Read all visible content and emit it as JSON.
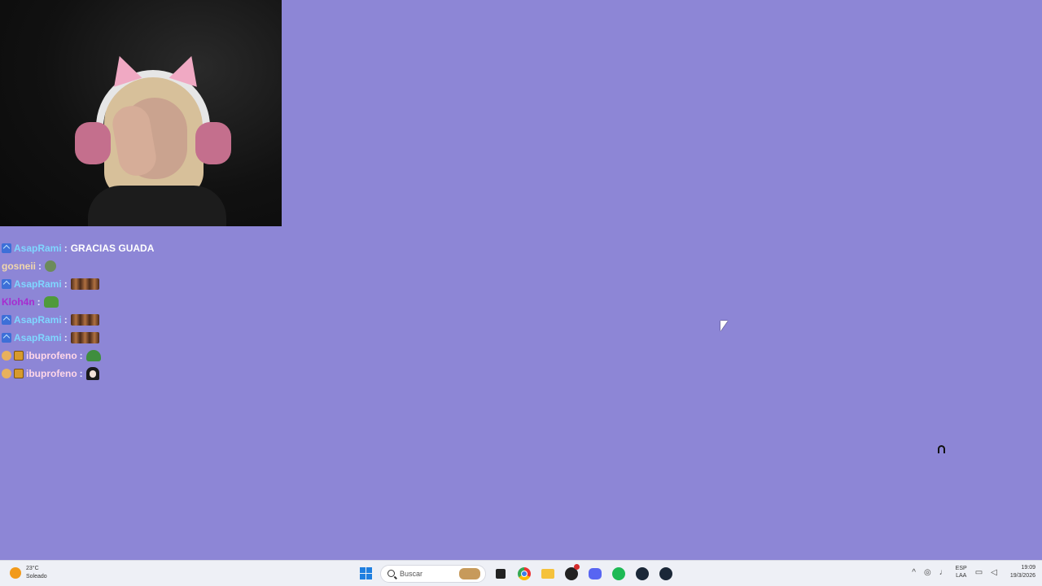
{
  "chat": {
    "messages": [
      {
        "badges": [
          "prime"
        ],
        "user": "AsapRami",
        "color": "#7fd6ff",
        "text": "GRACIAS GUADA",
        "emote": ""
      },
      {
        "badges": [],
        "user": "gosneii",
        "color": "#f1d7ab",
        "text": "",
        "emote": "frog"
      },
      {
        "badges": [
          "prime"
        ],
        "user": "AsapRami",
        "color": "#7fd6ff",
        "text": "",
        "emote": "trio"
      },
      {
        "badges": [],
        "user": "Kloh4n",
        "color": "#a72bd0",
        "text": "",
        "emote": "pepe"
      },
      {
        "badges": [
          "prime"
        ],
        "user": "AsapRami",
        "color": "#7fd6ff",
        "text": "",
        "emote": "trio"
      },
      {
        "badges": [
          "prime"
        ],
        "user": "AsapRami",
        "color": "#7fd6ff",
        "text": "",
        "emote": "trio"
      },
      {
        "badges": [
          "circle",
          "crate"
        ],
        "user": "ibuprofeno",
        "color": "#ffd7e8",
        "text": "",
        "emote": "bowl"
      },
      {
        "badges": [
          "circle",
          "crate"
        ],
        "user": "ibuprofeno",
        "color": "#ffd7e8",
        "text": "",
        "emote": "girl"
      }
    ],
    "separator": ":"
  },
  "taskbar": {
    "weather": {
      "temp": "23°C",
      "condition": "Soleado"
    },
    "search": {
      "placeholder": "Buscar"
    },
    "tray": {
      "lang_line1": "ESP",
      "lang_line2": "LAA",
      "time": "19:09",
      "date": "19/3/2026"
    }
  },
  "colors": {
    "background": "#8d86d6",
    "taskbar": "#eef0f6"
  }
}
